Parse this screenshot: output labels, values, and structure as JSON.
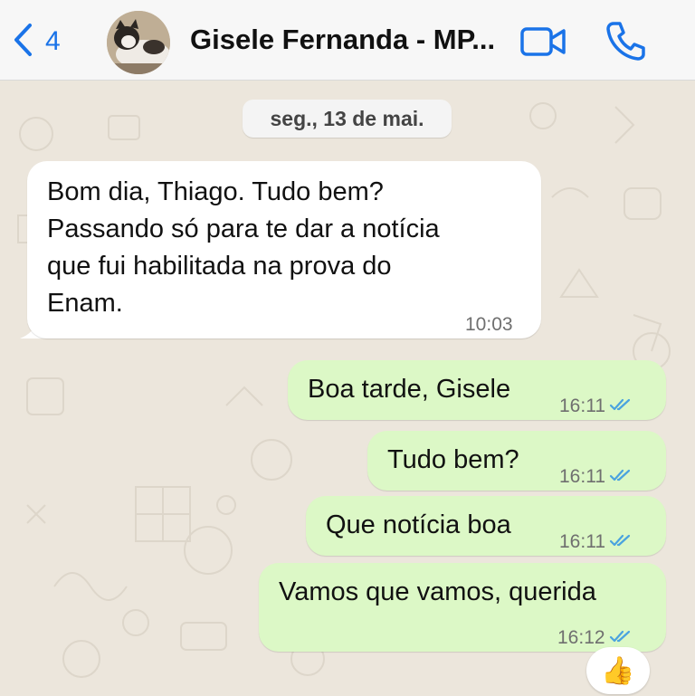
{
  "header": {
    "back_count": "4",
    "contact_name": "Gisele Fernanda - MP...",
    "icons": {
      "back": "chevron-left-icon",
      "video": "video-camera-icon",
      "call": "phone-icon"
    },
    "accent_color": "#1a73e8"
  },
  "chat": {
    "date_separator": "seg., 13 de mai.",
    "messages": [
      {
        "direction": "incoming",
        "lines": [
          "Bom dia, Thiago. Tudo bem?",
          "Passando só para te dar a notícia",
          "que fui habilitada na prova do",
          "Enam."
        ],
        "time": "10:03"
      },
      {
        "direction": "outgoing",
        "text": "Boa tarde, Gisele",
        "time": "16:11",
        "status": "read"
      },
      {
        "direction": "outgoing",
        "text": "Tudo bem?",
        "time": "16:11",
        "status": "read"
      },
      {
        "direction": "outgoing",
        "text": "Que notícia boa",
        "time": "16:11",
        "status": "read"
      },
      {
        "direction": "outgoing",
        "text": "Vamos que vamos, querida",
        "time": "16:12",
        "status": "read",
        "reaction": "👍"
      }
    ],
    "colors": {
      "incoming": "#ffffff",
      "outgoing": "#dcf8c6",
      "read_ticks": "#4aa3df"
    }
  }
}
